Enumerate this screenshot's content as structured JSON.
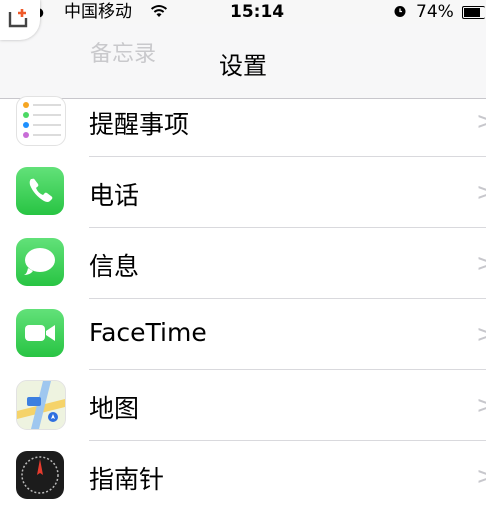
{
  "status_bar": {
    "signal": "●●",
    "carrier": "中国移动",
    "time": "15:14",
    "battery": "74%",
    "battery_level": 0.74
  },
  "nav": {
    "back_ghost": "备忘录",
    "title": "设置"
  },
  "rows": [
    {
      "label": "提醒事项",
      "icon": "reminders-icon"
    },
    {
      "label": "电话",
      "icon": "phone-icon"
    },
    {
      "label": "信息",
      "icon": "messages-icon"
    },
    {
      "label": "FaceTime",
      "icon": "facetime-icon"
    },
    {
      "label": "地图",
      "icon": "maps-icon"
    },
    {
      "label": "指南针",
      "icon": "compass-icon"
    }
  ],
  "chevron": ">",
  "colors": {
    "green": "#3fd25a",
    "separator": "#d9d9dd",
    "chevron": "#c7c7cc"
  }
}
